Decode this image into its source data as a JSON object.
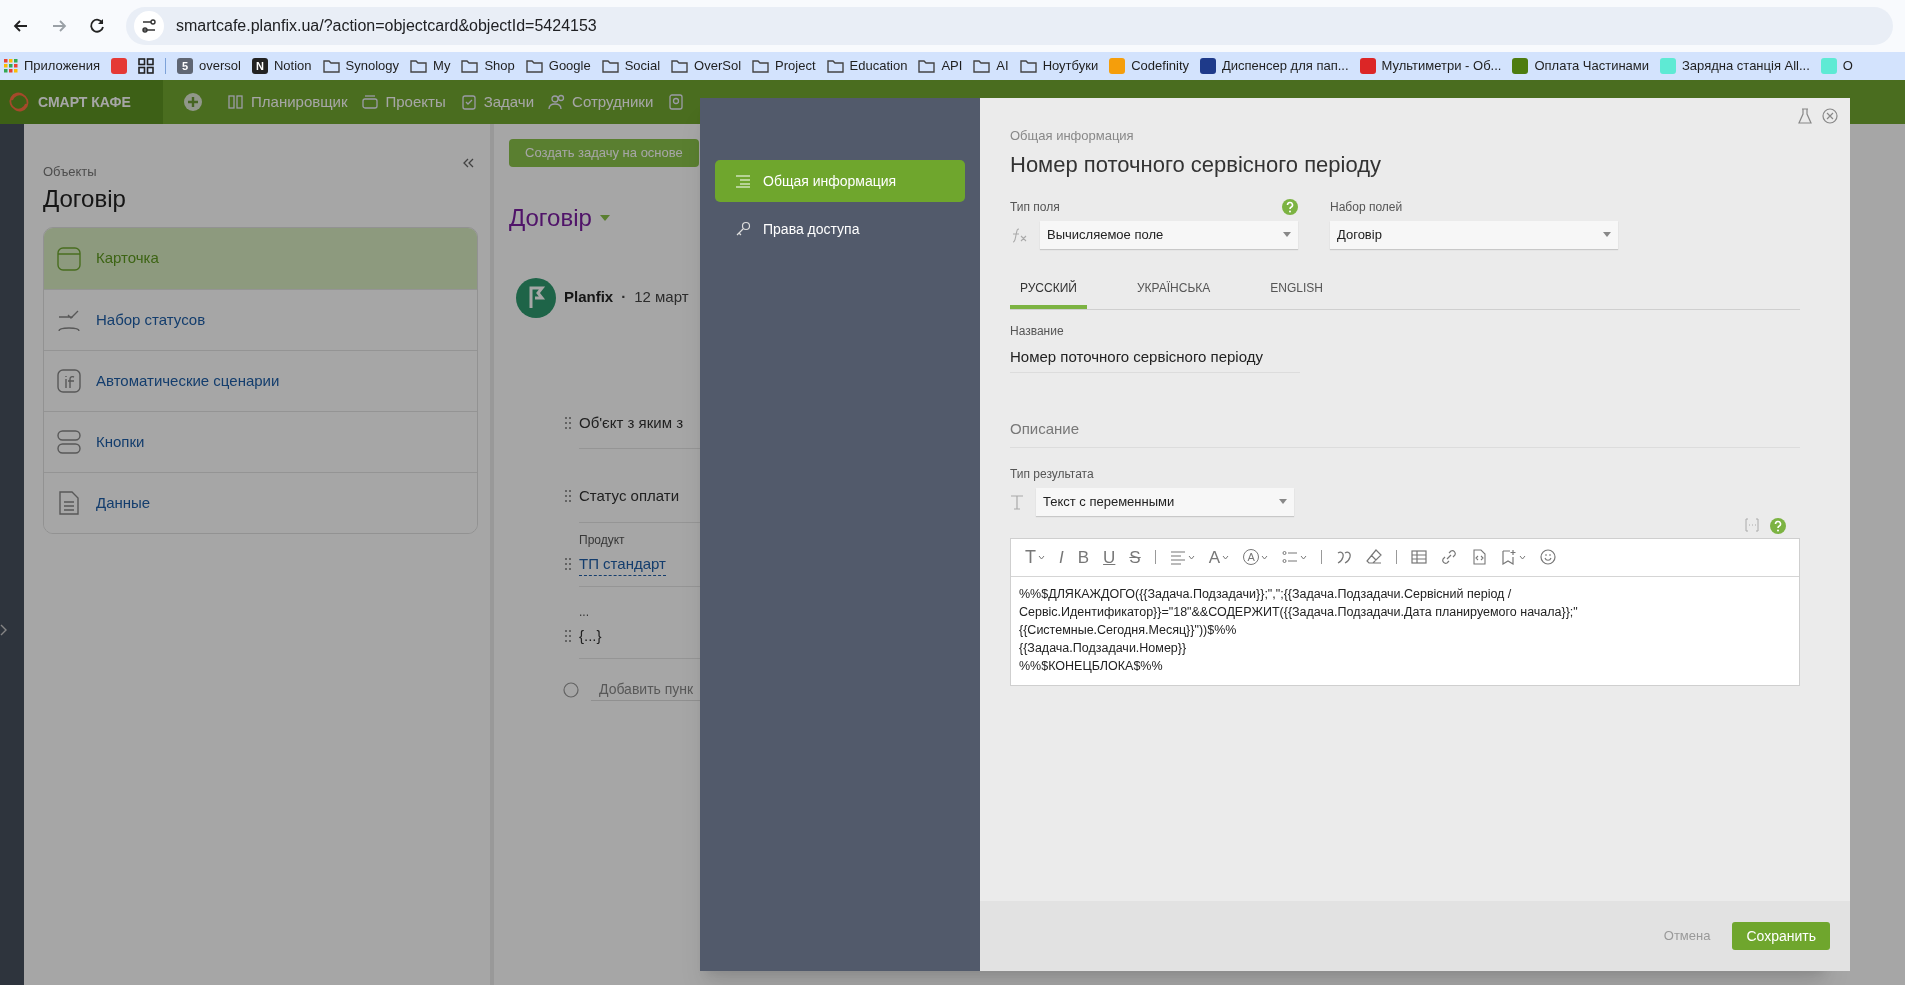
{
  "browser": {
    "url": "smartcafe.planfix.ua/?action=objectcard&objectId=5424153",
    "bookmarks": [
      {
        "kind": "apps",
        "label": "Приложения"
      },
      {
        "kind": "favicon",
        "color": "#e53935"
      },
      {
        "kind": "grid"
      },
      {
        "kind": "divider"
      },
      {
        "kind": "favicon",
        "color": "#5f6673",
        "glyph": "5",
        "label": "oversol"
      },
      {
        "kind": "favicon",
        "color": "#222222",
        "glyph": "N",
        "label": "Notion"
      },
      {
        "kind": "folder",
        "label": "Synology"
      },
      {
        "kind": "folder",
        "label": "My"
      },
      {
        "kind": "folder",
        "label": "Shop"
      },
      {
        "kind": "folder",
        "label": "Google"
      },
      {
        "kind": "folder",
        "label": "Social"
      },
      {
        "kind": "folder",
        "label": "OverSol"
      },
      {
        "kind": "folder",
        "label": "Project"
      },
      {
        "kind": "folder",
        "label": "Education"
      },
      {
        "kind": "folder",
        "label": "API"
      },
      {
        "kind": "folder",
        "label": "AI"
      },
      {
        "kind": "folder",
        "label": "Ноутбуки"
      },
      {
        "kind": "favicon",
        "color": "#f59e0b",
        "label": "Codefinity"
      },
      {
        "kind": "favicon",
        "color": "#1e3a8a",
        "label": "Диспенсер для пап..."
      },
      {
        "kind": "favicon",
        "color": "#dc2626",
        "label": "Мультиметри - Об..."
      },
      {
        "kind": "favicon",
        "color": "#4d7c0f",
        "label": "Оплата Частинами"
      },
      {
        "kind": "favicon",
        "color": "#5eead4",
        "label": "Зарядна станція All..."
      },
      {
        "kind": "favicon",
        "color": "#5eead4",
        "label": "O"
      }
    ]
  },
  "app_nav": {
    "logo": "СМАРТ КАФЕ",
    "items": [
      "Планировщик",
      "Проекты",
      "Задачи",
      "Сотрудники"
    ]
  },
  "objects_panel": {
    "breadcrumb": "Объекты",
    "title": "Договір",
    "items": [
      {
        "label": "Карточка",
        "selected": true
      },
      {
        "label": "Набор статусов",
        "selected": false
      },
      {
        "label": "Автоматические сценарии",
        "selected": false
      },
      {
        "label": "Кнопки",
        "selected": false
      },
      {
        "label": "Данные",
        "selected": false
      }
    ]
  },
  "card": {
    "create_button": "Создать задачу на основе",
    "title": "Договір",
    "author": "Planfix",
    "separator": "·",
    "date": "12 март",
    "fields": [
      {
        "value": "Об'єкт з яким з",
        "link": false
      },
      {
        "value": "Статус оплати",
        "link": false
      },
      {
        "label": "Продукт",
        "value": "ТП стандарт",
        "link": true
      },
      {
        "label": "...",
        "value": "{...}",
        "link": false
      }
    ],
    "add_item": "Добавить пунк"
  },
  "modal": {
    "nav": [
      {
        "label": "Общая информация",
        "selected": true
      },
      {
        "label": "Права доступа",
        "selected": false
      }
    ],
    "breadcrumb": "Общая информация",
    "title": "Номер поточного сервісного періоду",
    "field_type": {
      "label": "Тип поля",
      "value": "Вычисляемое поле"
    },
    "field_set": {
      "label": "Набор полей",
      "value": "Договір"
    },
    "languages": [
      {
        "label": "РУССКИЙ",
        "selected": true
      },
      {
        "label": "УКРАЇНСЬКА",
        "selected": false
      },
      {
        "label": "ENGLISH",
        "selected": false
      }
    ],
    "name": {
      "label": "Название",
      "value": "Номер поточного сервісного періоду"
    },
    "description": {
      "placeholder": "Описание"
    },
    "result_type": {
      "label": "Тип результата",
      "value": "Текст с переменными"
    },
    "toolbar": [
      {
        "kind": "text-style",
        "glyph": "T",
        "caret": true
      },
      {
        "kind": "italic",
        "glyph": "I",
        "caret": false
      },
      {
        "kind": "bold",
        "glyph": "B",
        "caret": false
      },
      {
        "kind": "underline",
        "glyph": "U",
        "caret": false
      },
      {
        "kind": "strike",
        "glyph": "S",
        "caret": false
      },
      {
        "kind": "divider"
      },
      {
        "kind": "align",
        "caret": true
      },
      {
        "kind": "font-color",
        "glyph": "A",
        "caret": true
      },
      {
        "kind": "highlight",
        "glyph": "A",
        "caret": true
      },
      {
        "kind": "list",
        "caret": true
      },
      {
        "kind": "divider"
      },
      {
        "kind": "quote",
        "caret": false
      },
      {
        "kind": "eraser",
        "caret": false
      },
      {
        "kind": "divider"
      },
      {
        "kind": "table",
        "caret": false
      },
      {
        "kind": "link",
        "caret": false
      },
      {
        "kind": "code",
        "caret": false
      },
      {
        "kind": "bookmark",
        "caret": true
      },
      {
        "kind": "smiley",
        "caret": false
      }
    ],
    "editor_lines": [
      "%%$ДЛЯКАЖДОГО({{Задача.Подзадачи}};\",\";{{Задача.Подзадачи.Сервісний період /",
      "Сервіс.Идентификатор}}=\"18\"&&СОДЕРЖИТ({{Задача.Подзадачи.Дата планируемого начала}};\"",
      "{{Системные.Сегодня.Месяц}}\"))$%%",
      "{{Задача.Подзадачи.Номер}}",
      "%%$КОНЕЦБЛОКА$%%"
    ],
    "cancel": "Отмена",
    "save": "Сохранить"
  }
}
